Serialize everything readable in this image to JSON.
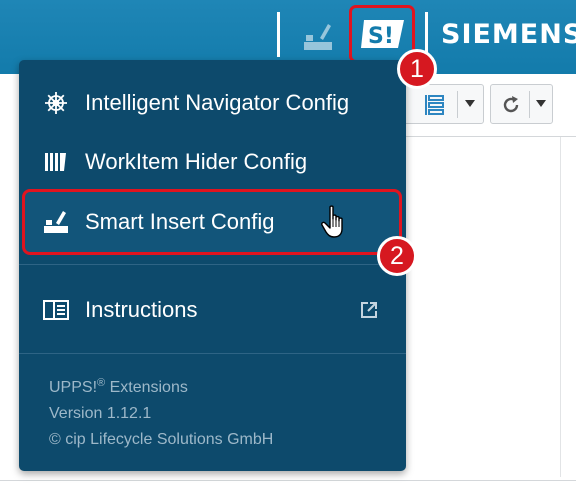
{
  "topbar": {
    "brand": "SIEMENS",
    "upps_logo_text": "S!"
  },
  "badges": {
    "step1": "1",
    "step2": "2"
  },
  "menu": {
    "items": [
      {
        "label": "Intelligent Navigator Config",
        "icon": "navigator-wheel-icon"
      },
      {
        "label": "WorkItem Hider Config",
        "icon": "workitem-hider-icon"
      },
      {
        "label": "Smart Insert Config",
        "icon": "smart-insert-icon"
      },
      {
        "label": "Instructions",
        "icon": "instructions-book-icon"
      }
    ],
    "footer": {
      "product": "UPPS!",
      "registered": "®",
      "product_suffix": " Extensions",
      "version": "Version 1.12.1",
      "copyright": "© cip Lifecycle Solutions GmbH"
    }
  },
  "colors": {
    "topbar": "#1a82b3",
    "menu_bg": "#0d4a6c",
    "highlight_border": "#e0141f",
    "badge": "#d61820"
  }
}
